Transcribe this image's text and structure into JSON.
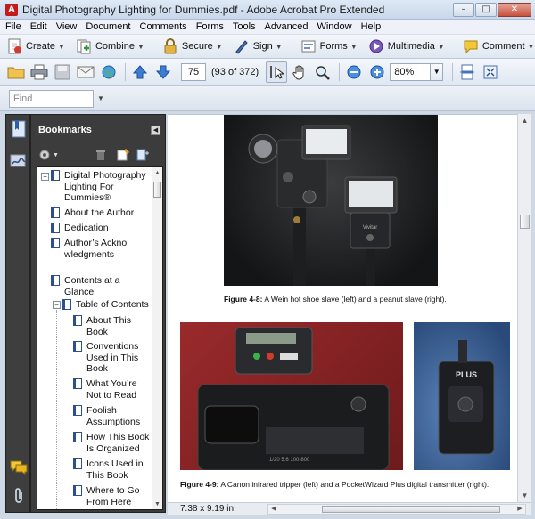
{
  "window": {
    "title": "Digital Photography Lighting for Dummies.pdf - Adobe Acrobat Pro Extended",
    "app_icon_text": "A",
    "minimize": "–",
    "maximize": "□",
    "close": "✕"
  },
  "menu": [
    "File",
    "Edit",
    "View",
    "Document",
    "Comments",
    "Forms",
    "Tools",
    "Advanced",
    "Window",
    "Help"
  ],
  "toolbar1": {
    "create": "Create",
    "combine": "Combine",
    "secure": "Secure",
    "sign": "Sign",
    "forms": "Forms",
    "multimedia": "Multimedia",
    "comment": "Comment"
  },
  "toolbar2": {
    "page_number": "75",
    "page_count": "(93 of 372)",
    "zoom": "80%"
  },
  "find": {
    "placeholder": "Find"
  },
  "bookmarks": {
    "title": "Bookmarks",
    "items": [
      {
        "label": "Digital Photography Lighting For Dummies®"
      },
      {
        "label": "About the Author"
      },
      {
        "label": "Dedication"
      },
      {
        "label": "Author’s Acknowledgments"
      },
      {
        "label": "Contents at a Glance"
      },
      {
        "label": "Table of Contents"
      },
      {
        "label": "About This Book"
      },
      {
        "label": "Conventions Used in This Book"
      },
      {
        "label": "What You’re Not to Read"
      },
      {
        "label": "Foolish Assumptions"
      },
      {
        "label": "How This Book Is Organized"
      },
      {
        "label": "Icons Used in This Book"
      },
      {
        "label": "Where to Go From Here"
      }
    ]
  },
  "document": {
    "figure_4_8": {
      "label": "Figure 4-8:",
      "text": " A Wein hot shoe slave (left) and a peanut slave (right)."
    },
    "figure_4_9": {
      "label": "Figure 4-9:",
      "text": " A Canon infrared tripper (left) and a PocketWizard Plus digital transmitter (right)."
    },
    "photo_text": {
      "flash_brand": "Vivitar",
      "camera_screen": "1/20  5.6     100-800",
      "transmitter_label": "PLUS"
    }
  },
  "statusbar": {
    "page_size": "7.38 x 9.19 in"
  },
  "colors": {
    "accent_blue": "#2b4f90",
    "panel_dark": "#3c3c3c",
    "photo_red_bg": "#8e2527",
    "photo_blue_bg": "#3d6296"
  }
}
